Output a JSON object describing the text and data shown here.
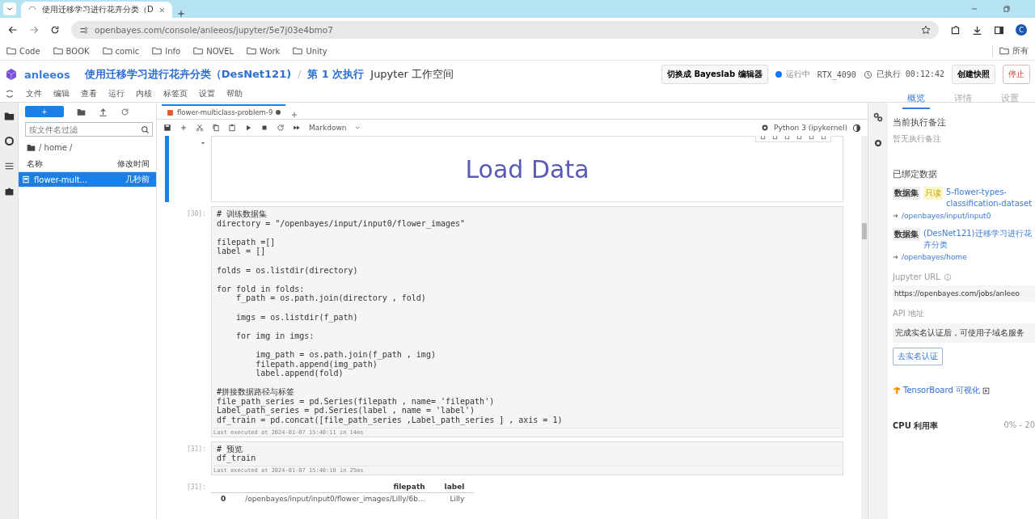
{
  "browser": {
    "tab_title": "使用迁移学习进行花卉分类（D",
    "url": "openbayes.com/console/anleeos/jupyter/5e7j03e4bmo7",
    "bookmarks": [
      "Code",
      "BOOK",
      "comic",
      "Info",
      "NOVEL",
      "Work",
      "Unity"
    ],
    "bookmarks_more": "所有",
    "profile_initial": "C"
  },
  "header": {
    "user": "anleeos",
    "project": "使用迁移学习进行花卉分类（DesNet121)",
    "separator": "/",
    "execution": "第 1 次执行",
    "workspace": "Jupyter 工作空间",
    "switch_button": "切换成 Bayeslab 编辑器",
    "status": {
      "label": "运行中",
      "color": "#1677ff"
    },
    "gpu": "RTX_4090",
    "elapsed": "已执行 00:12:42",
    "snapshot_button": "创建快照",
    "stop_button": "停止"
  },
  "menu": [
    "文件",
    "编辑",
    "查看",
    "运行",
    "内核",
    "标签页",
    "设置",
    "帮助"
  ],
  "file_browser": {
    "new_button": "+",
    "search_placeholder": "按文件名过滤",
    "path": "/ home /",
    "columns": [
      "名称",
      "修改时间"
    ],
    "files": [
      {
        "name": "flower-mult...",
        "modified": "几秒前",
        "selected": true
      }
    ]
  },
  "notebook": {
    "tab": {
      "title": "flower-multiclass-problem-9",
      "unsaved": true
    },
    "cell_type": "Markdown",
    "kernel": "Python 3 (ipykernel)",
    "cells": [
      {
        "kind": "markdown",
        "selected": true,
        "heading": "Load Data"
      },
      {
        "kind": "code",
        "selected": false,
        "prompt": "[30]:",
        "code": "# 训练数据集\ndirectory = \"/openbayes/input/input0/flower_images\"\n\nfilepath =[]\nlabel = []\n\nfolds = os.listdir(directory)\n\nfor fold in folds:\n    f_path = os.path.join(directory , fold)\n\n    imgs = os.listdir(f_path)\n\n    for img in imgs:\n\n        img_path = os.path.join(f_path , img)\n        filepath.append(img_path)\n        label.append(fold)\n\n#拼接数据路径与标签\nfile_path_series = pd.Series(filepath , name= 'filepath')\nLabel_path_series = pd.Series(label , name = 'label')\ndf_train = pd.concat([file_path_series ,Label_path_series ] , axis = 1)",
        "exec_info": "Last executed at 2024-01-07 15:40:11 in 14ms"
      },
      {
        "kind": "code",
        "selected": false,
        "prompt": "[31]:",
        "code": "# 预览\ndf_train",
        "exec_info": "Last executed at 2024-01-07 15:40:18 in 25ms"
      },
      {
        "kind": "output",
        "selected": false,
        "prompt": "[31]:",
        "columns": [
          "filepath",
          "label"
        ],
        "rows": [
          {
            "index": "0",
            "cells": [
              "/openbayes/input/input0/flower_images/Lilly/6b...",
              "Lilly"
            ]
          }
        ]
      }
    ]
  },
  "right_panel": {
    "tabs": [
      {
        "label": "概览",
        "selected": true
      },
      {
        "label": "详情",
        "selected": false
      },
      {
        "label": "设置",
        "selected": false
      }
    ],
    "note_title": "当前执行备注",
    "note_empty": "暂无执行备注",
    "bound_title": "已绑定数据",
    "datasets": [
      {
        "tag": "数据集",
        "badge": "只读",
        "name": "5-flower-types-classification-dataset",
        "path": "/openbayes/input/input0"
      },
      {
        "tag": "数据集",
        "name": "(DesNet121)迁移学习进行花卉分类",
        "path": "/openbayes/home"
      }
    ],
    "jupyter_url_label": "Jupyter URL",
    "jupyter_url": "https://openbayes.com/jobs/anleeo",
    "api_label": "API 地址",
    "api_value": "完成实名认证后，可使用子域名服务",
    "verify_button": "去实名认证",
    "tensorboard": "TensorBoard 可视化",
    "cpu_label": "CPU 利用率",
    "cpu_value": "0% - 20"
  }
}
